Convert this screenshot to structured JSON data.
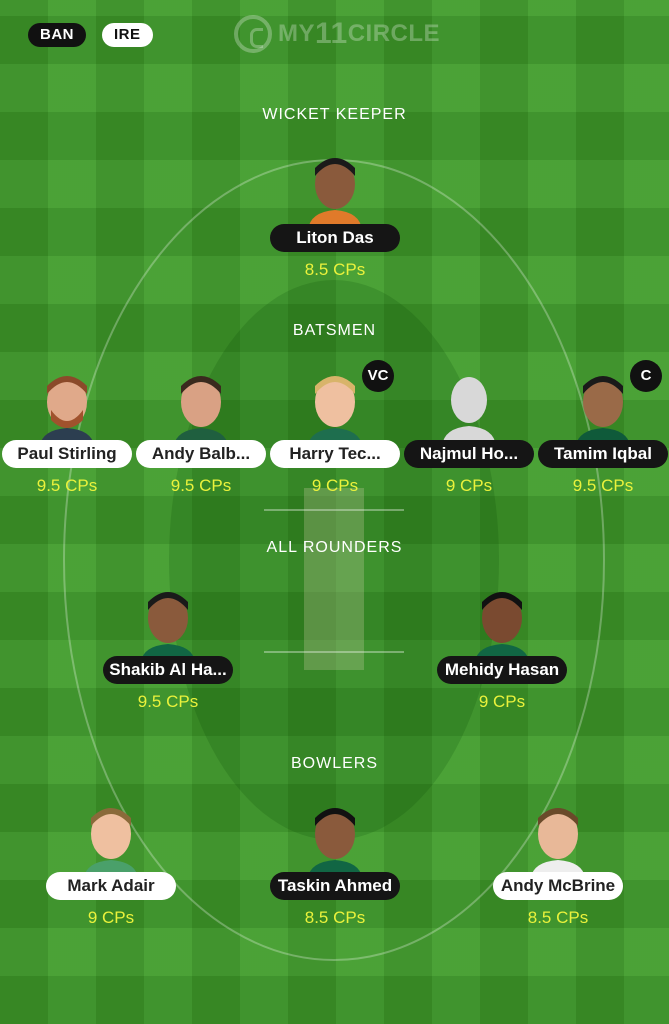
{
  "teams": {
    "ban": "BAN",
    "ire": "IRE"
  },
  "watermark": {
    "prefix": "MY",
    "number": "11",
    "suffix": "CIRCLE"
  },
  "sections": {
    "wicket_keeper": "WICKET KEEPER",
    "batsmen": "BATSMEN",
    "all_rounders": "ALL ROUNDERS",
    "bowlers": "BOWLERS"
  },
  "players": {
    "wk1": {
      "name": "Liton Das",
      "cps": "8.5 CPs",
      "team": "ban"
    },
    "bat1": {
      "name": "Paul Stirling",
      "cps": "9.5 CPs",
      "team": "ire"
    },
    "bat2": {
      "name": "Andy Balb...",
      "cps": "9.5 CPs",
      "team": "ire"
    },
    "bat3": {
      "name": "Harry Tec...",
      "cps": "9 CPs",
      "team": "ire",
      "badge": "VC"
    },
    "bat4": {
      "name": "Najmul Ho...",
      "cps": "9 CPs",
      "team": "ban"
    },
    "bat5": {
      "name": "Tamim Iqbal",
      "cps": "9.5 CPs",
      "team": "ban",
      "badge": "C"
    },
    "ar1": {
      "name": "Shakib Al Ha...",
      "cps": "9.5 CPs",
      "team": "ban"
    },
    "ar2": {
      "name": "Mehidy Hasan",
      "cps": "9 CPs",
      "team": "ban"
    },
    "bowl1": {
      "name": "Mark Adair",
      "cps": "9 CPs",
      "team": "ire"
    },
    "bowl2": {
      "name": "Taskin Ahmed",
      "cps": "8.5 CPs",
      "team": "ban"
    },
    "bowl3": {
      "name": "Andy McBrine",
      "cps": "8.5 CPs",
      "team": "ire"
    }
  },
  "colors": {
    "field": "#3f9c2a",
    "credits_text": "#eaf23c",
    "ban_pill": "#151515",
    "ire_pill": "#ffffff"
  },
  "icons": {
    "player_photo": "player-avatar-icon",
    "placeholder": "default-avatar-icon",
    "logo": "my11circle-logo-icon"
  }
}
